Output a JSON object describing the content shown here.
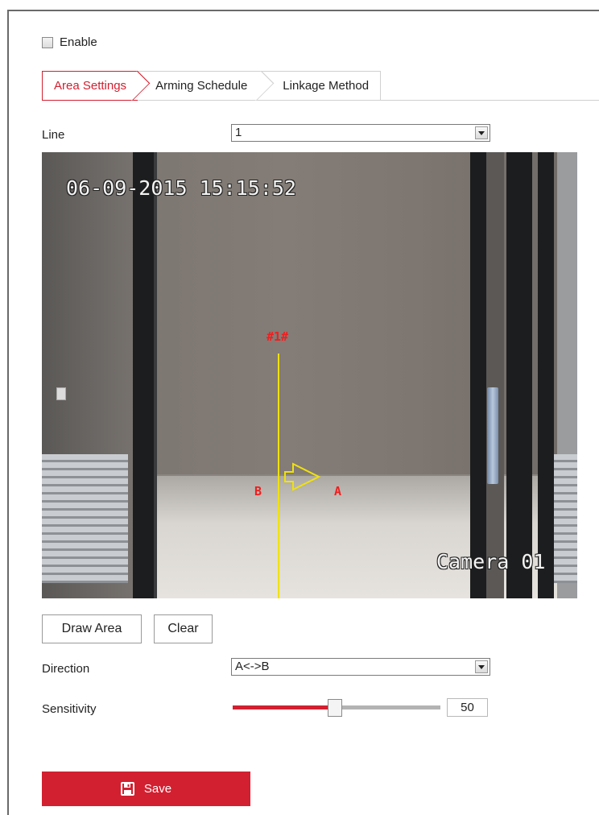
{
  "enable": {
    "label": "Enable",
    "checked": false
  },
  "tabs": [
    {
      "label": "Area Settings",
      "active": true
    },
    {
      "label": "Arming Schedule",
      "active": false
    },
    {
      "label": "Linkage Method",
      "active": false
    }
  ],
  "line": {
    "label": "Line",
    "value": "1"
  },
  "video": {
    "timestamp": "06-09-2015 15:15:52",
    "camera_name": "Camera 01",
    "rule_label": "#1#",
    "side_b": "B",
    "side_a": "A"
  },
  "buttons": {
    "draw_area": "Draw Area",
    "clear": "Clear"
  },
  "direction": {
    "label": "Direction",
    "value": "A<->B"
  },
  "sensitivity": {
    "label": "Sensitivity",
    "value": "50"
  },
  "save": {
    "label": "Save",
    "icon": "floppy-disk-icon"
  },
  "colors": {
    "accent": "#d22030",
    "rule_line": "#f0e10c",
    "rule_text": "#f21d1d"
  }
}
